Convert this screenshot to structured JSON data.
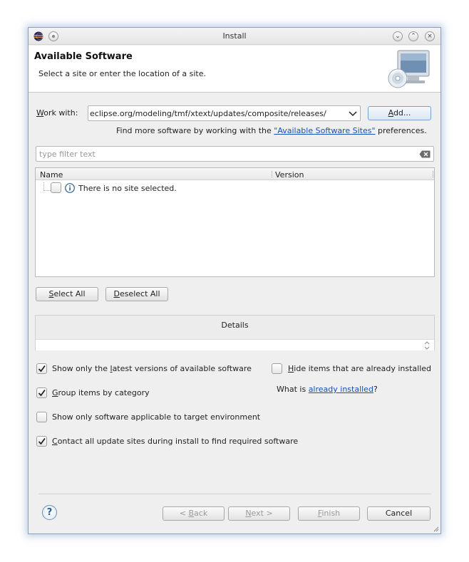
{
  "window": {
    "title": "Install"
  },
  "header": {
    "title": "Available Software",
    "description": "Select a site or enter the location of a site."
  },
  "work_with": {
    "label_prefix": "W",
    "label_rest": "ork with:",
    "value": "eclipse.org/modeling/tmf/xtext/updates/composite/releases/",
    "add_button": {
      "prefix": "",
      "mnemonic": "A",
      "rest": "dd..."
    }
  },
  "more_software": {
    "text_before": "Find more software by working with the ",
    "link": "\"Available Software Sites\"",
    "text_after": " preferences."
  },
  "filter": {
    "placeholder": "type filter text"
  },
  "tree": {
    "columns": [
      "Name",
      "Version"
    ],
    "message": "There is no site selected."
  },
  "buttons": {
    "select_all": {
      "mnemonic": "S",
      "rest": "elect All"
    },
    "deselect_all": {
      "mnemonic": "D",
      "rest": "eselect All"
    }
  },
  "details": {
    "title": "Details"
  },
  "options": {
    "latest_versions": {
      "before": "Show only the ",
      "mnemonic": "l",
      "after": "atest versions of available software",
      "checked": true
    },
    "hide_installed": {
      "mnemonic": "H",
      "after": "ide items that are already installed",
      "checked": false
    },
    "group_by_category": {
      "mnemonic": "G",
      "after": "roup items by category",
      "checked": true
    },
    "what_is_prefix": "What is ",
    "already_installed_link": "already installed",
    "what_is_suffix": "?",
    "target_env": {
      "label": "Show only software applicable to target environment",
      "checked": false
    },
    "contact_sites": {
      "mnemonic": "C",
      "after": "ontact all update sites during install to find required software",
      "checked": true
    }
  },
  "footer": {
    "back": {
      "before": "< ",
      "mnemonic": "B",
      "after": "ack"
    },
    "next": {
      "mnemonic": "N",
      "after": "ext >"
    },
    "finish": {
      "mnemonic": "F",
      "after": "inish"
    },
    "cancel": "Cancel"
  },
  "colors": {
    "link": "#1a4fb4",
    "window_border": "#8ba0bb",
    "dialog_bg": "#efefef"
  }
}
